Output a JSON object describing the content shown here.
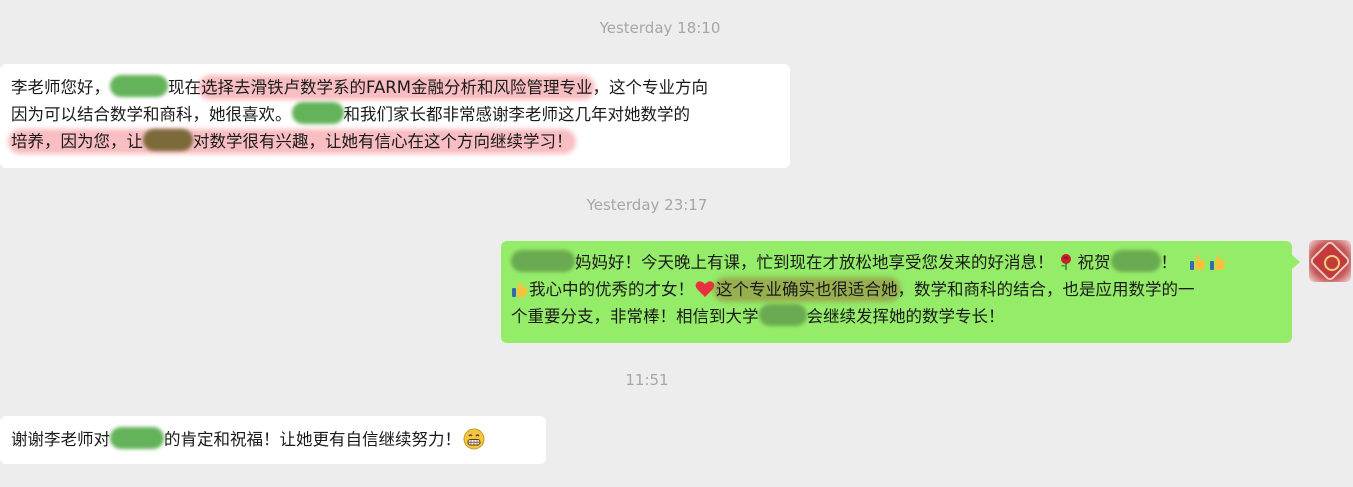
{
  "timestamps": [
    "Yesterday 18:10",
    "Yesterday 23:17",
    "11:51"
  ],
  "messages": [
    {
      "from": "other",
      "lines": [
        [
          "李老师您好，",
          "现在",
          "选择去滑铁卢数学系的FARM金融分析和风险管理专业",
          "，这个专业方向"
        ],
        [
          "因为可以结合数学和商科，她很喜欢。",
          "和我们家长都非常感谢李老师这几年对她数学的"
        ],
        [
          "培养，",
          "因为您，让",
          "对数学很有兴趣，让她有信心在这个方向继续学习！"
        ]
      ]
    },
    {
      "from": "me",
      "lines": [
        [
          "妈妈好！今天晚上有课，忙到现在才放松地享受您发来的好消息！",
          "祝贺",
          "！"
        ],
        [
          "我心中的优秀的才女！",
          "这个专业确实也很适合她",
          "，数学和商科的结合，也是应用数学的一"
        ],
        [
          "个重要分支，非常棒！相信到大学",
          "会继续发挥她的数学专长！"
        ]
      ]
    },
    {
      "from": "other",
      "lines": [
        [
          "谢谢李老师对",
          "的肯定和祝福！让她更有自信继续努力！"
        ]
      ]
    }
  ],
  "colors": {
    "background": "#ededed",
    "incoming_bubble": "#ffffff",
    "outgoing_bubble": "#95ec69",
    "highlight_red": "#f06e78",
    "timestamp_text": "#a6a6a6"
  },
  "icons": [
    "rose-icon",
    "thumbs-up-icon",
    "red-heart-icon",
    "grinning-face-icon",
    "contact-avatar"
  ]
}
